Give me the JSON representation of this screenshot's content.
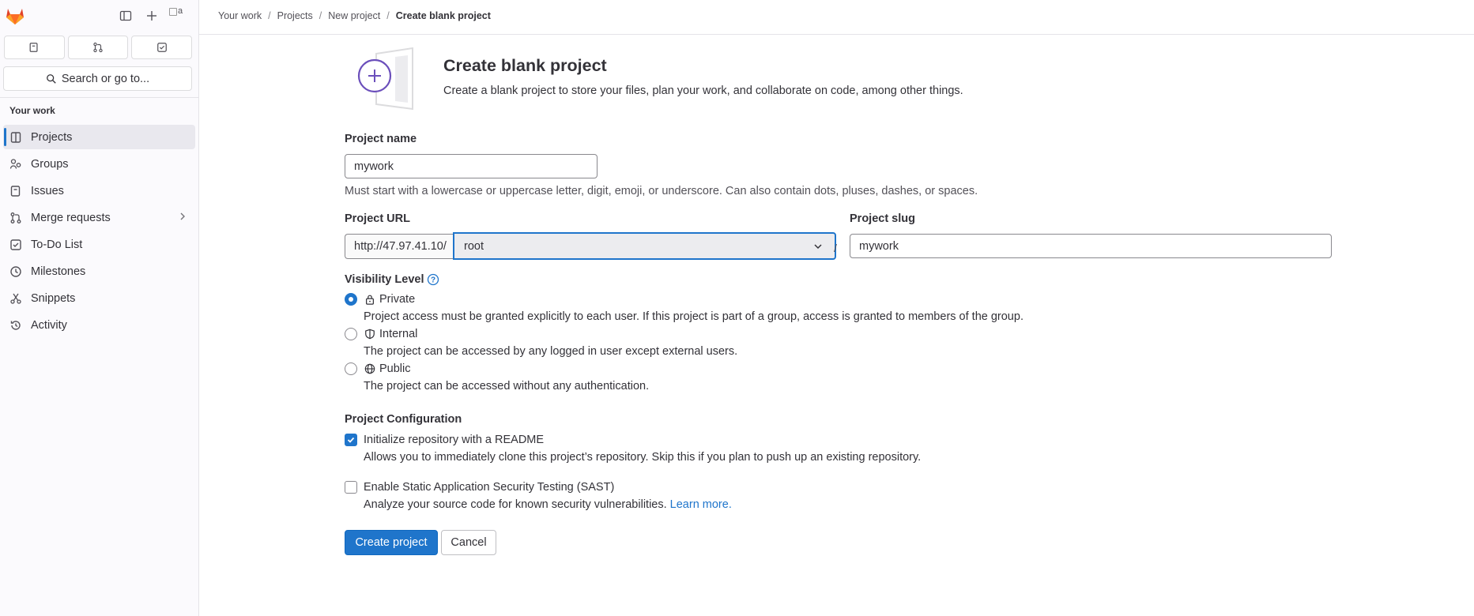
{
  "sidebar": {
    "search_label": "Search or go to...",
    "avatar_alt": "a",
    "section_title": "Your work",
    "items": [
      {
        "label": "Projects",
        "icon": "project-icon"
      },
      {
        "label": "Groups",
        "icon": "group-icon"
      },
      {
        "label": "Issues",
        "icon": "issues-icon"
      },
      {
        "label": "Merge requests",
        "icon": "merge-request-icon"
      },
      {
        "label": "To-Do List",
        "icon": "todo-icon"
      },
      {
        "label": "Milestones",
        "icon": "clock-icon"
      },
      {
        "label": "Snippets",
        "icon": "snippet-icon"
      },
      {
        "label": "Activity",
        "icon": "history-icon"
      }
    ]
  },
  "breadcrumb": [
    "Your work",
    "Projects",
    "New project",
    "Create blank project"
  ],
  "header": {
    "title": "Create blank project",
    "description": "Create a blank project to store your files, plan your work, and collaborate on code, among other things."
  },
  "form": {
    "project_name_label": "Project name",
    "project_name_value": "mywork",
    "project_name_help": "Must start with a lowercase or uppercase letter, digit, emoji, or underscore. Can also contain dots, pluses, dashes, or spaces.",
    "project_url_label": "Project URL",
    "url_prefix": "http://47.97.41.10/",
    "namespace": "root",
    "url_separator": "/",
    "project_slug_label": "Project slug",
    "project_slug_value": "mywork",
    "visibility_label": "Visibility Level",
    "visibility": [
      {
        "label": "Private",
        "desc": "Project access must be granted explicitly to each user. If this project is part of a group, access is granted to members of the group.",
        "checked": true
      },
      {
        "label": "Internal",
        "desc": "The project can be accessed by any logged in user except external users.",
        "checked": false
      },
      {
        "label": "Public",
        "desc": "The project can be accessed without any authentication.",
        "checked": false
      }
    ],
    "config_label": "Project Configuration",
    "readme_label": "Initialize repository with a README",
    "readme_desc": "Allows you to immediately clone this project’s repository. Skip this if you plan to push up an existing repository.",
    "sast_label": "Enable Static Application Security Testing (SAST)",
    "sast_desc": "Analyze your source code for known security vulnerabilities.",
    "sast_link": "Learn more.",
    "create_button": "Create project",
    "cancel_button": "Cancel"
  },
  "colors": {
    "accent": "#1f75cb",
    "brand": "#fc6d26"
  }
}
